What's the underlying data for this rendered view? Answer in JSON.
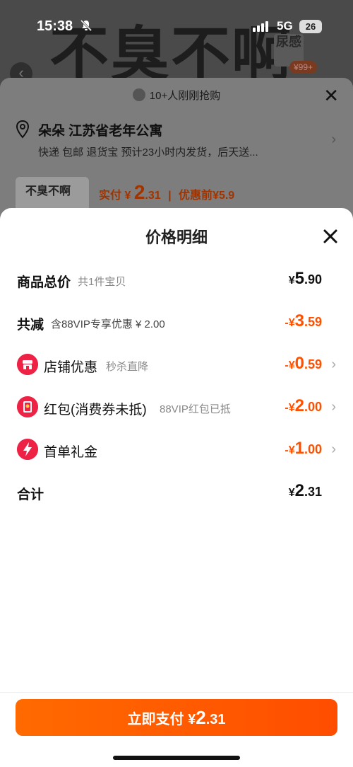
{
  "status": {
    "time": "15:38",
    "network": "5G",
    "battery": "26"
  },
  "background": {
    "product_banner_text": "不臭不啊",
    "badge_text": "尿感",
    "price_tag": "¥99+",
    "thumb_text": "不臭不啊"
  },
  "order_sheet": {
    "hint": "10+人刚刚抢购",
    "address_name": "朵朵 江苏省老年公寓",
    "address_sub": "快递 包邮 退货宝 预计23小时内发货，后天送...",
    "pay_label": "实付",
    "pay_yen": "¥",
    "pay_int": "2",
    "pay_dec": ".31",
    "pre_label": "优惠前",
    "pre_value": "¥5.9"
  },
  "modal": {
    "title": "价格明细",
    "rows": [
      {
        "label": "商品总价",
        "note": "共1件宝贝",
        "yen": "¥",
        "int": "5",
        "dec": ".90"
      },
      {
        "label": "共减",
        "note": "含88VIP专享优惠 ¥ 2.00",
        "yen": "-¥",
        "int": "3",
        "dec": ".59"
      },
      {
        "label": "店铺优惠",
        "note": "秒杀直降",
        "yen": "-¥",
        "int": "0",
        "dec": ".59"
      },
      {
        "label": "红包(消费券未抵)",
        "note": "88VIP红包已抵",
        "yen": "-¥",
        "int": "2",
        "dec": ".00"
      },
      {
        "label": "首单礼金",
        "note": "",
        "yen": "-¥",
        "int": "1",
        "dec": ".00"
      },
      {
        "label": "合计",
        "note": "",
        "yen": "¥",
        "int": "2",
        "dec": ".31"
      }
    ],
    "pay_button": {
      "label": "立即支付",
      "yen": "¥",
      "int": "2",
      "dec": ".31"
    }
  },
  "colors": {
    "accent": "#ff5000",
    "shop_icon": "#ee2244",
    "coupon_icon": "#ee2244",
    "gift_icon": "#ee2244"
  },
  "icons": [
    "bell-off-icon",
    "close-icon",
    "location-pin-icon",
    "shop-icon",
    "red-envelope-icon",
    "lightning-icon",
    "chevron-right-icon"
  ]
}
